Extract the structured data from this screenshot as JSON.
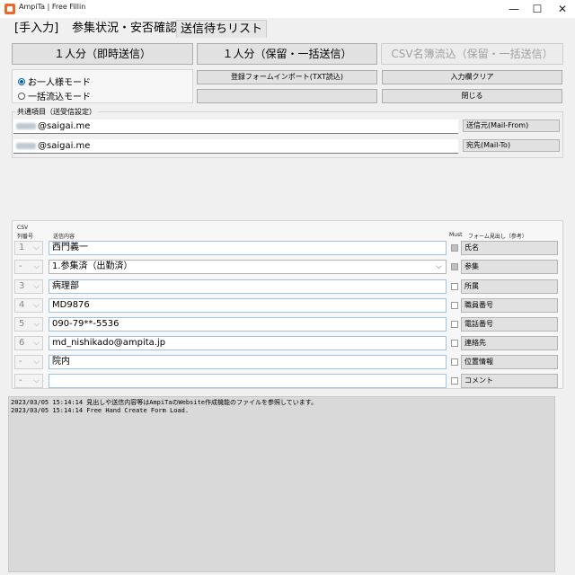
{
  "window": {
    "title": "AmpiTa | Free Fillin",
    "controls": [
      "—",
      "☐",
      "✕"
    ]
  },
  "tabs": [
    "[手入力]",
    "参集状況・安否確認",
    "送信待ちリスト"
  ],
  "send_buttons": {
    "single_now": "１人分（即時送信）",
    "single_hold": "１人分（保留・一括送信）",
    "csv_bulk": "CSV名簿流込（保留・一括送信）"
  },
  "modes": {
    "single": "お一人様モード",
    "bulk": "一括流込モード",
    "selected": "single"
  },
  "actions": {
    "import_form": "登録フォームインポート(TXT読込)",
    "clear_input": "入力欄クリア",
    "blank": "",
    "close": "閉じる"
  },
  "common": {
    "label": "共通項目（送受信設定）",
    "from_value": "@saigai.me",
    "from_button": "送信元(Mail-From)",
    "to_value": "@saigai.me",
    "to_button": "宛先(Mail-To)"
  },
  "columns": {
    "csv": "CSV",
    "col_no": "列番号",
    "content": "送信内容",
    "must": "Must",
    "form_heading": "フォーム見出し（参考）"
  },
  "rows": [
    {
      "col": "1",
      "value": "西門義一",
      "label": "氏名"
    },
    {
      "col": "-",
      "value": "1.参集済（出勤済）",
      "label": "参集"
    },
    {
      "col": "3",
      "value": "病理部",
      "label": "所属"
    },
    {
      "col": "4",
      "value": "MD9876",
      "label": "職員番号"
    },
    {
      "col": "5",
      "value": "090-79**-5536",
      "label": "電話番号"
    },
    {
      "col": "6",
      "value": "md_nishikado@ampita.jp",
      "label": "連絡先"
    },
    {
      "col": "-",
      "value": "院内",
      "label": "位置情報"
    },
    {
      "col": "-",
      "value": "",
      "label": "コメント"
    }
  ],
  "log": [
    "2023/03/05 15:14:14 見出しや送信内容等はAmpiTaのWebsite作成機能のファイルを参照しています。",
    "2023/03/05 15:14:14 Free Hand Create Form Load."
  ]
}
